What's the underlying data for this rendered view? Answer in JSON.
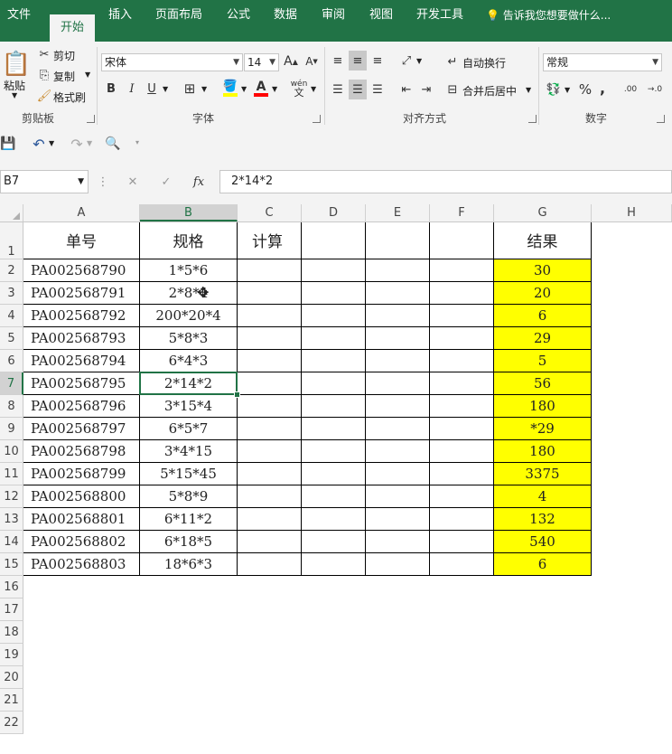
{
  "tabs": [
    "文件",
    "开始",
    "插入",
    "页面布局",
    "公式",
    "数据",
    "审阅",
    "视图",
    "开发工具"
  ],
  "active_tab": "开始",
  "tell_me": "告诉我您想要做什么...",
  "clipboard": {
    "paste": "粘贴",
    "cut": "剪切",
    "copy": "复制",
    "format_painter": "格式刷",
    "label": "剪贴板"
  },
  "font": {
    "name": "宋体",
    "size": "14",
    "label": "字体",
    "bold": "B",
    "italic": "I",
    "underline": "U",
    "phonetic": "wén"
  },
  "alignment": {
    "wrap_text": "自动换行",
    "merge_center": "合并后居中",
    "label": "对齐方式"
  },
  "number": {
    "format": "常规",
    "percent": "%",
    "comma": ",",
    "label": "数字",
    "inc_decimal": ".00",
    "dec_decimal": "→.0"
  },
  "name_box": "B7",
  "formula": "2*14*2",
  "fx": "fx",
  "columns": [
    "A",
    "B",
    "C",
    "D",
    "E",
    "F",
    "G",
    "H"
  ],
  "rows": [
    "1",
    "2",
    "3",
    "4",
    "5",
    "6",
    "7",
    "8",
    "9",
    "10",
    "11",
    "12",
    "13",
    "14",
    "15",
    "16",
    "17",
    "18",
    "19",
    "20",
    "21",
    "22"
  ],
  "headers": {
    "a": "单号",
    "b": "规格",
    "c": "计算",
    "g": "结果"
  },
  "table": [
    {
      "a": "PA002568790",
      "b": "1*5*6",
      "g": "30"
    },
    {
      "a": "PA002568791",
      "b": "2*8*4",
      "g": "20"
    },
    {
      "a": "PA002568792",
      "b": "200*20*4",
      "g": "6"
    },
    {
      "a": "PA002568793",
      "b": "5*8*3",
      "g": "29"
    },
    {
      "a": "PA002568794",
      "b": "6*4*3",
      "g": "5"
    },
    {
      "a": "PA002568795",
      "b": "2*14*2",
      "g": "56"
    },
    {
      "a": "PA002568796",
      "b": "3*15*4",
      "g": "180"
    },
    {
      "a": "PA002568797",
      "b": "6*5*7",
      "g": "*29"
    },
    {
      "a": "PA002568798",
      "b": "3*4*15",
      "g": "180"
    },
    {
      "a": "PA002568799",
      "b": "5*15*45",
      "g": "3375"
    },
    {
      "a": "PA002568800",
      "b": "5*8*9",
      "g": "4"
    },
    {
      "a": "PA002568801",
      "b": "6*11*2",
      "g": "132"
    },
    {
      "a": "PA002568802",
      "b": "6*18*5",
      "g": "540"
    },
    {
      "a": "PA002568803",
      "b": "18*6*3",
      "g": "6"
    }
  ],
  "colors": {
    "brand": "#217346",
    "highlight": "#ffff00"
  }
}
